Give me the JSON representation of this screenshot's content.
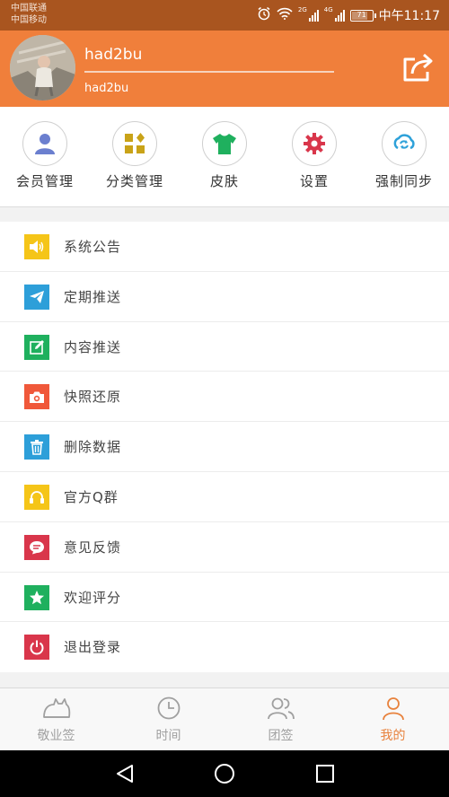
{
  "status_bar": {
    "carrier_1": "中国联通",
    "carrier_2": "中国移动",
    "net_1": "2G",
    "net_2": "4G",
    "battery": "71",
    "battery_level": 0.71,
    "time": "中午11:17"
  },
  "profile": {
    "username": "had2bu",
    "nickname": "had2bu"
  },
  "quick_actions": [
    {
      "label": "会员管理",
      "icon": "member-icon",
      "color": "#6b7fcf"
    },
    {
      "label": "分类管理",
      "icon": "category-icon",
      "color": "#c9a318"
    },
    {
      "label": "皮肤",
      "icon": "tshirt-icon",
      "color": "#1fb05e"
    },
    {
      "label": "设置",
      "icon": "gear-icon",
      "color": "#d9364b"
    },
    {
      "label": "强制同步",
      "icon": "sync-icon",
      "color": "#2ea1d9"
    }
  ],
  "menu": [
    {
      "label": "系统公告",
      "icon": "speaker-icon",
      "color": "#f5c518"
    },
    {
      "label": "定期推送",
      "icon": "paper-plane-icon",
      "color": "#2d9fd9"
    },
    {
      "label": "内容推送",
      "icon": "edit-icon",
      "color": "#1fb05e"
    },
    {
      "label": "快照还原",
      "icon": "camera-icon",
      "color": "#f0583a"
    },
    {
      "label": "删除数据",
      "icon": "trash-icon",
      "color": "#2d9fd9"
    },
    {
      "label": "官方Q群",
      "icon": "headphones-icon",
      "color": "#f5c518"
    },
    {
      "label": "意见反馈",
      "icon": "chat-bubble-icon",
      "color": "#d9364b"
    },
    {
      "label": "欢迎评分",
      "icon": "star-icon",
      "color": "#1fb05e"
    },
    {
      "label": "退出登录",
      "icon": "power-icon",
      "color": "#d9364b"
    }
  ],
  "tabs": [
    {
      "label": "敬业签",
      "icon": "cat-icon",
      "active": false
    },
    {
      "label": "时间",
      "icon": "clock-icon",
      "active": false
    },
    {
      "label": "团签",
      "icon": "team-icon",
      "active": false
    },
    {
      "label": "我的",
      "icon": "person-icon",
      "active": true
    }
  ],
  "colors": {
    "header": "#f07f3b",
    "status_bar": "#a9551f",
    "tab_active": "#e8823d",
    "tab_inactive": "#a0a0a0"
  }
}
